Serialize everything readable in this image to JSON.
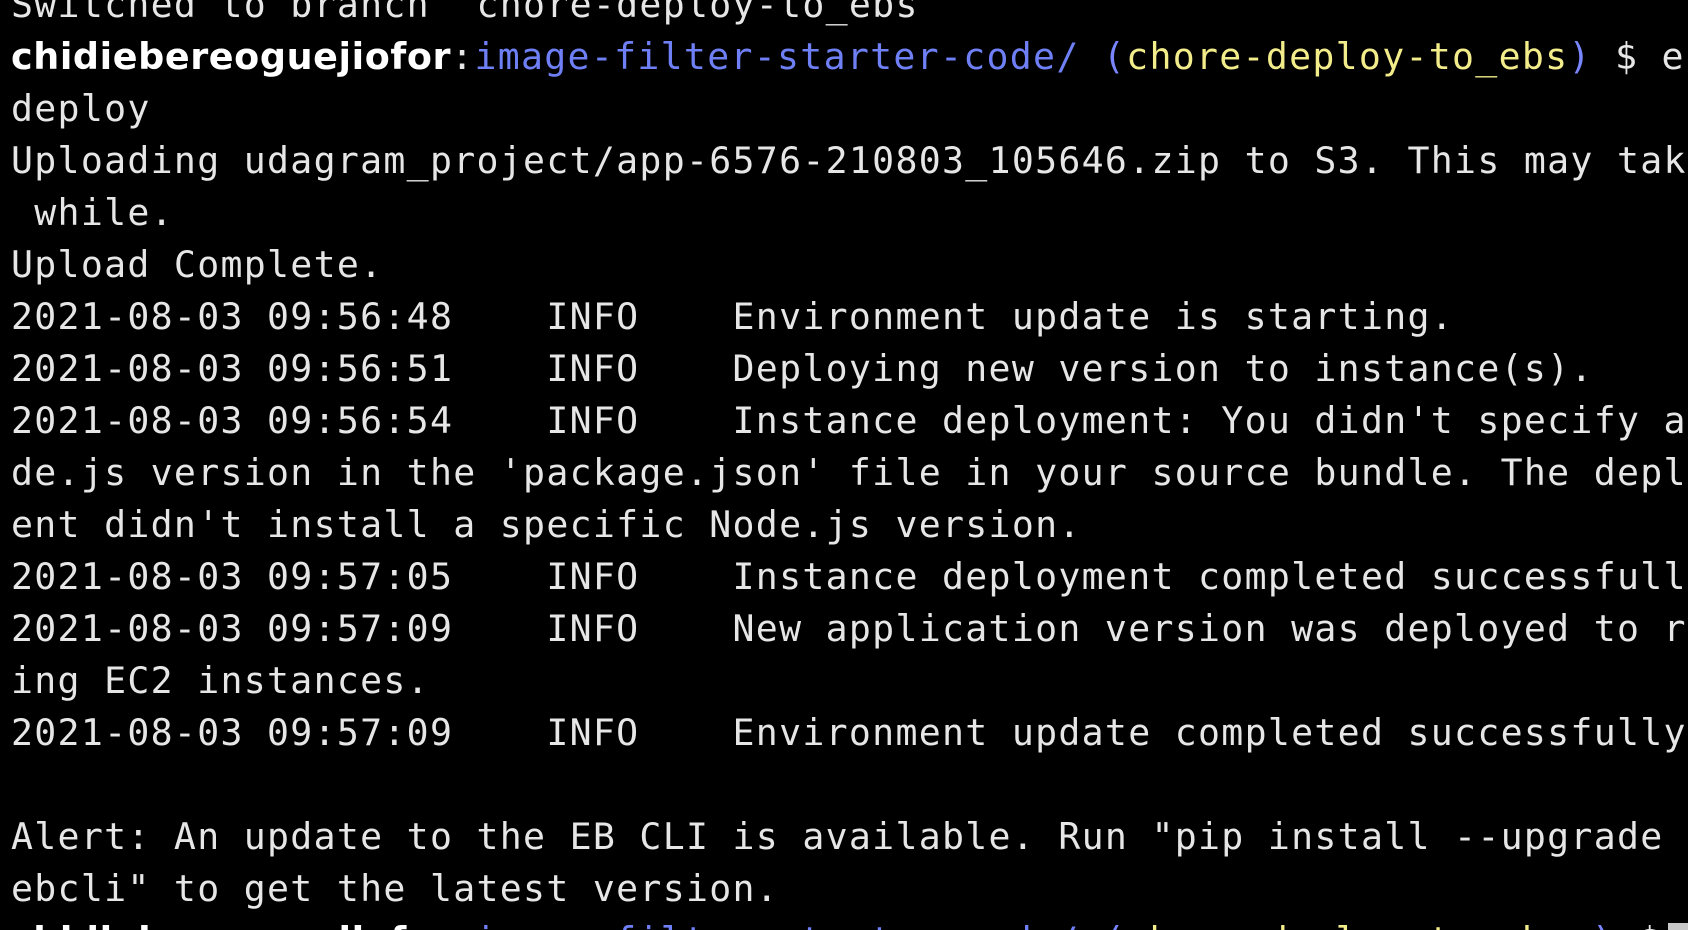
{
  "colors": {
    "background": "#000000",
    "text": "#e6e6e6",
    "username": "#ffffff",
    "path": "#6f7ff5",
    "branch": "#f2ec8a",
    "dirty_marker": "#ff4a4a"
  },
  "terminal": {
    "previous_output": "Switched to branch 'chore-deploy-to_ebs'",
    "prompt": {
      "user": "chidiebereoguejiofor",
      "sep": ":",
      "path": "image-filter-starter-code/",
      "paren_open": " (",
      "branch": "chore-deploy-to_ebs",
      "paren_close": ")",
      "symbol": " $ ",
      "command_part1": "eb",
      "command_part2": "deploy"
    },
    "output": [
      "Uploading udagram_project/app-6576-210803_105646.zip to S3. This may take a",
      " while.",
      "Upload Complete.",
      "2021-08-03 09:56:48    INFO    Environment update is starting.",
      "2021-08-03 09:56:51    INFO    Deploying new version to instance(s).",
      "2021-08-03 09:56:54    INFO    Instance deployment: You didn't specify a No",
      "de.js version in the 'package.json' file in your source bundle. The deploym",
      "ent didn't install a specific Node.js version.",
      "2021-08-03 09:57:05    INFO    Instance deployment completed successfully.",
      "2021-08-03 09:57:09    INFO    New application version was deployed to runn",
      "ing EC2 instances.",
      "2021-08-03 09:57:09    INFO    Environment update completed successfully.",
      "",
      "Alert: An update to the EB CLI is available. Run \"pip install --upgrade aws",
      "ebcli\" to get the latest version."
    ],
    "final_prompt": {
      "user": "chidiebereoguejiofor",
      "sep": ":",
      "path": "image-filter-starter-code/",
      "paren_open": " (",
      "branch": "chore-deploy-to_ebs",
      "dirty": "✗",
      "paren_close": ")",
      "symbol": " $"
    }
  }
}
